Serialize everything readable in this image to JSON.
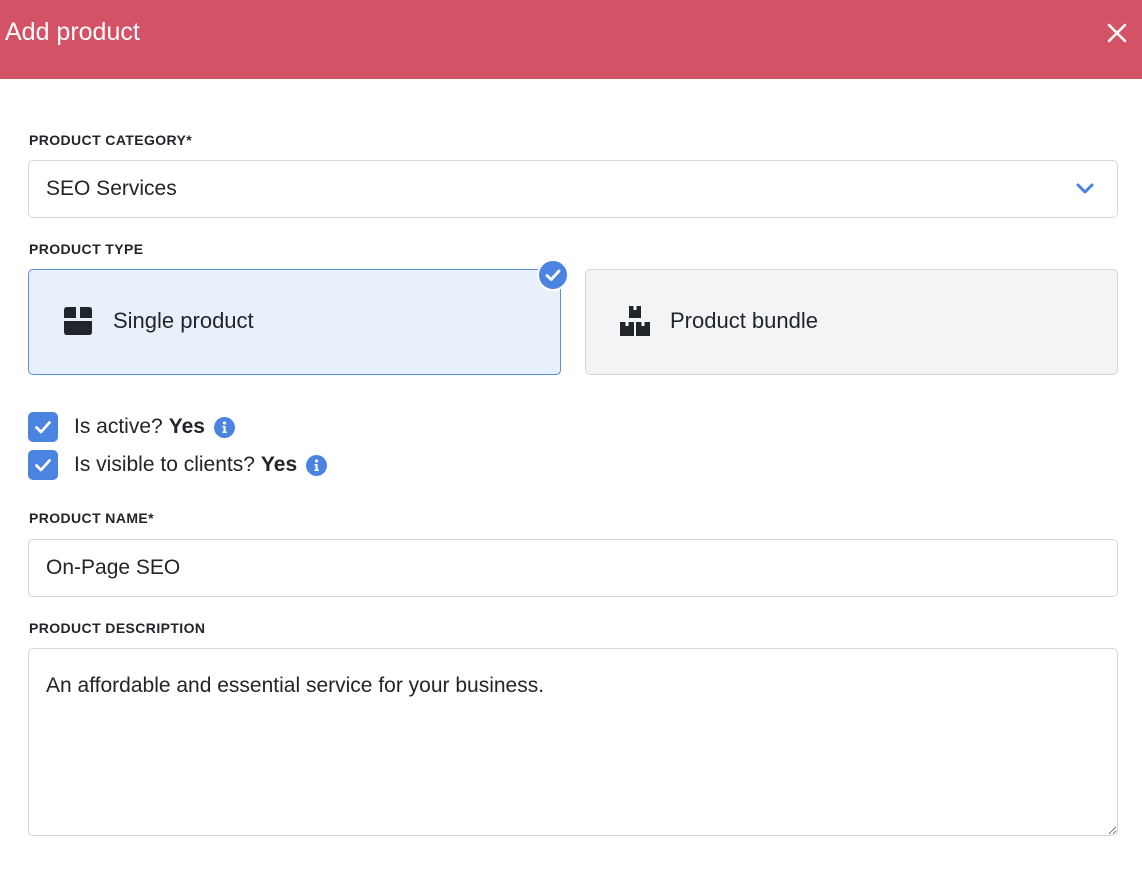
{
  "header": {
    "title": "Add product",
    "close_icon": "close-icon"
  },
  "product_category": {
    "label": "PRODUCT CATEGORY*",
    "value": "SEO Services",
    "icon": "chevron-down-icon"
  },
  "product_type": {
    "label": "PRODUCT TYPE",
    "options": [
      {
        "label": "Single product",
        "icon": "box-icon",
        "selected": true
      },
      {
        "label": "Product bundle",
        "icon": "boxes-icon",
        "selected": false
      }
    ]
  },
  "checkboxes": [
    {
      "label": "Is active?",
      "value": "Yes",
      "checked": true
    },
    {
      "label": "Is visible to clients?",
      "value": "Yes",
      "checked": true
    }
  ],
  "product_name": {
    "label": "PRODUCT NAME*",
    "value": "On-Page SEO"
  },
  "product_description": {
    "label": "PRODUCT DESCRIPTION",
    "value": "An affordable and essential service for your business."
  },
  "colors": {
    "header_bg": "#d45266",
    "accent": "#4a84e0",
    "selected_card_bg": "#e8f0fc",
    "unselected_card_bg": "#f3f4f6"
  }
}
